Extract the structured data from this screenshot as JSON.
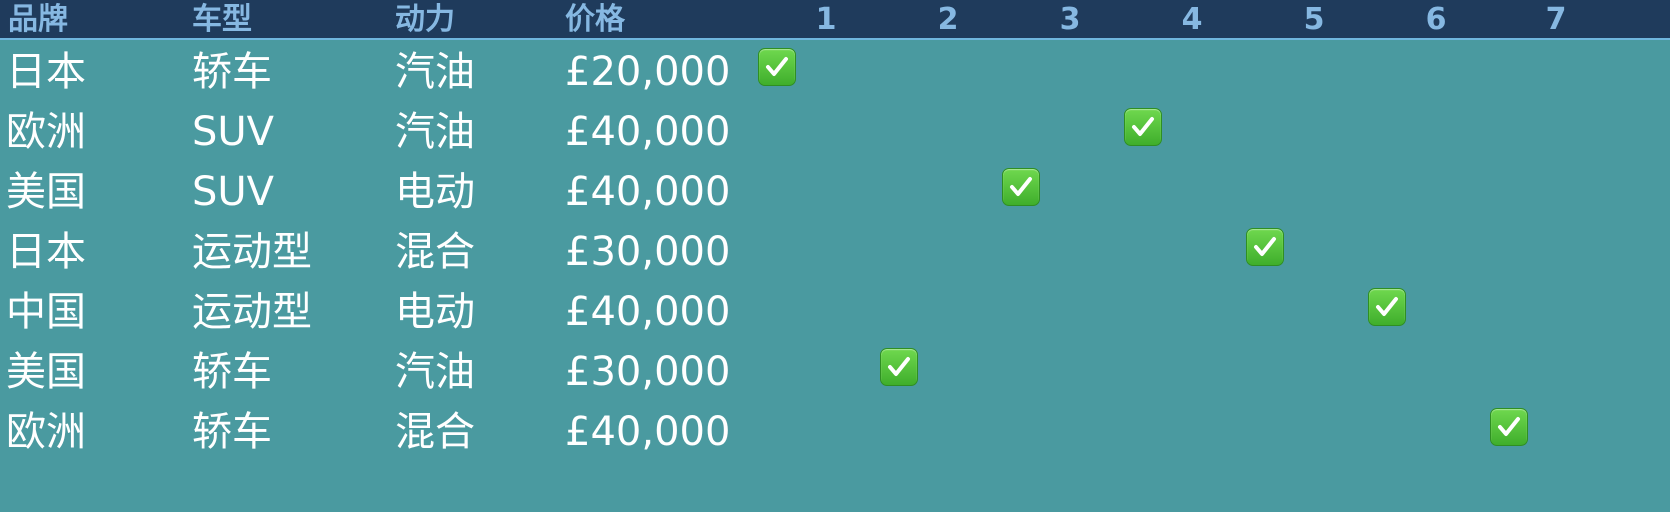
{
  "header": {
    "columns": [
      "品牌",
      "车型",
      "动力",
      "价格"
    ],
    "numbers": [
      "1",
      "2",
      "3",
      "4",
      "5",
      "6",
      "7"
    ]
  },
  "rows": [
    {
      "brand": "日本",
      "type": "轿车",
      "power": "汽油",
      "price": "£20,000",
      "check": 1
    },
    {
      "brand": "欧洲",
      "type": "SUV",
      "power": "汽油",
      "price": "£40,000",
      "check": 4
    },
    {
      "brand": "美国",
      "type": "SUV",
      "power": "电动",
      "price": "£40,000",
      "check": 3
    },
    {
      "brand": "日本",
      "type": "运动型",
      "power": "混合",
      "price": "£30,000",
      "check": 5
    },
    {
      "brand": "中国",
      "type": "运动型",
      "power": "电动",
      "price": "£40,000",
      "check": 6
    },
    {
      "brand": "美国",
      "type": "轿车",
      "power": "汽油",
      "price": "£30,000",
      "check": 2
    },
    {
      "brand": "欧洲",
      "type": "轿车",
      "power": "混合",
      "price": "£40,000",
      "check": 7
    }
  ],
  "colors": {
    "background": "#4a9aa0",
    "header_bg": "#1f3b5c",
    "header_text": "#86b8e2",
    "check_green": "#4cbb33"
  },
  "icon": "white-heavy-check-mark-icon"
}
